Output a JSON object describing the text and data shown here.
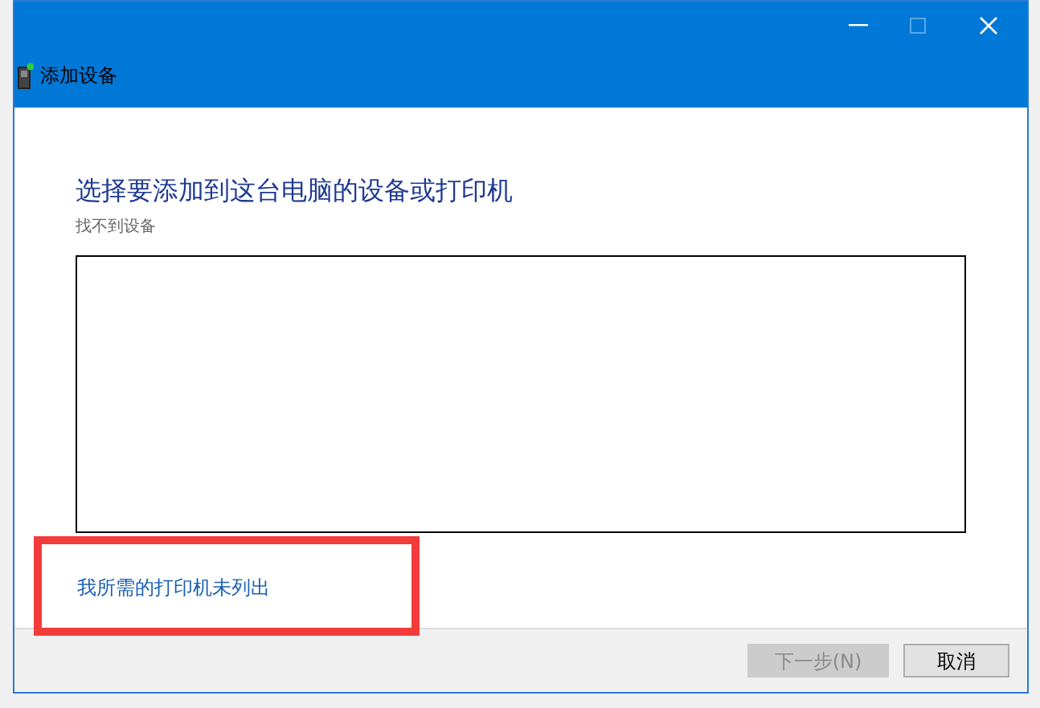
{
  "window": {
    "title": "添加设备",
    "maximize_disabled": true
  },
  "heading": "选择要添加到这台电脑的设备或打印机",
  "status": "找不到设备",
  "link": "我所需的打印机未列出",
  "buttons": [
    {
      "label": "下一步(N)",
      "disabled": true
    },
    {
      "label": "取消",
      "disabled": false
    }
  ],
  "annotations": [
    {
      "kind": "rectangle"
    }
  ]
}
